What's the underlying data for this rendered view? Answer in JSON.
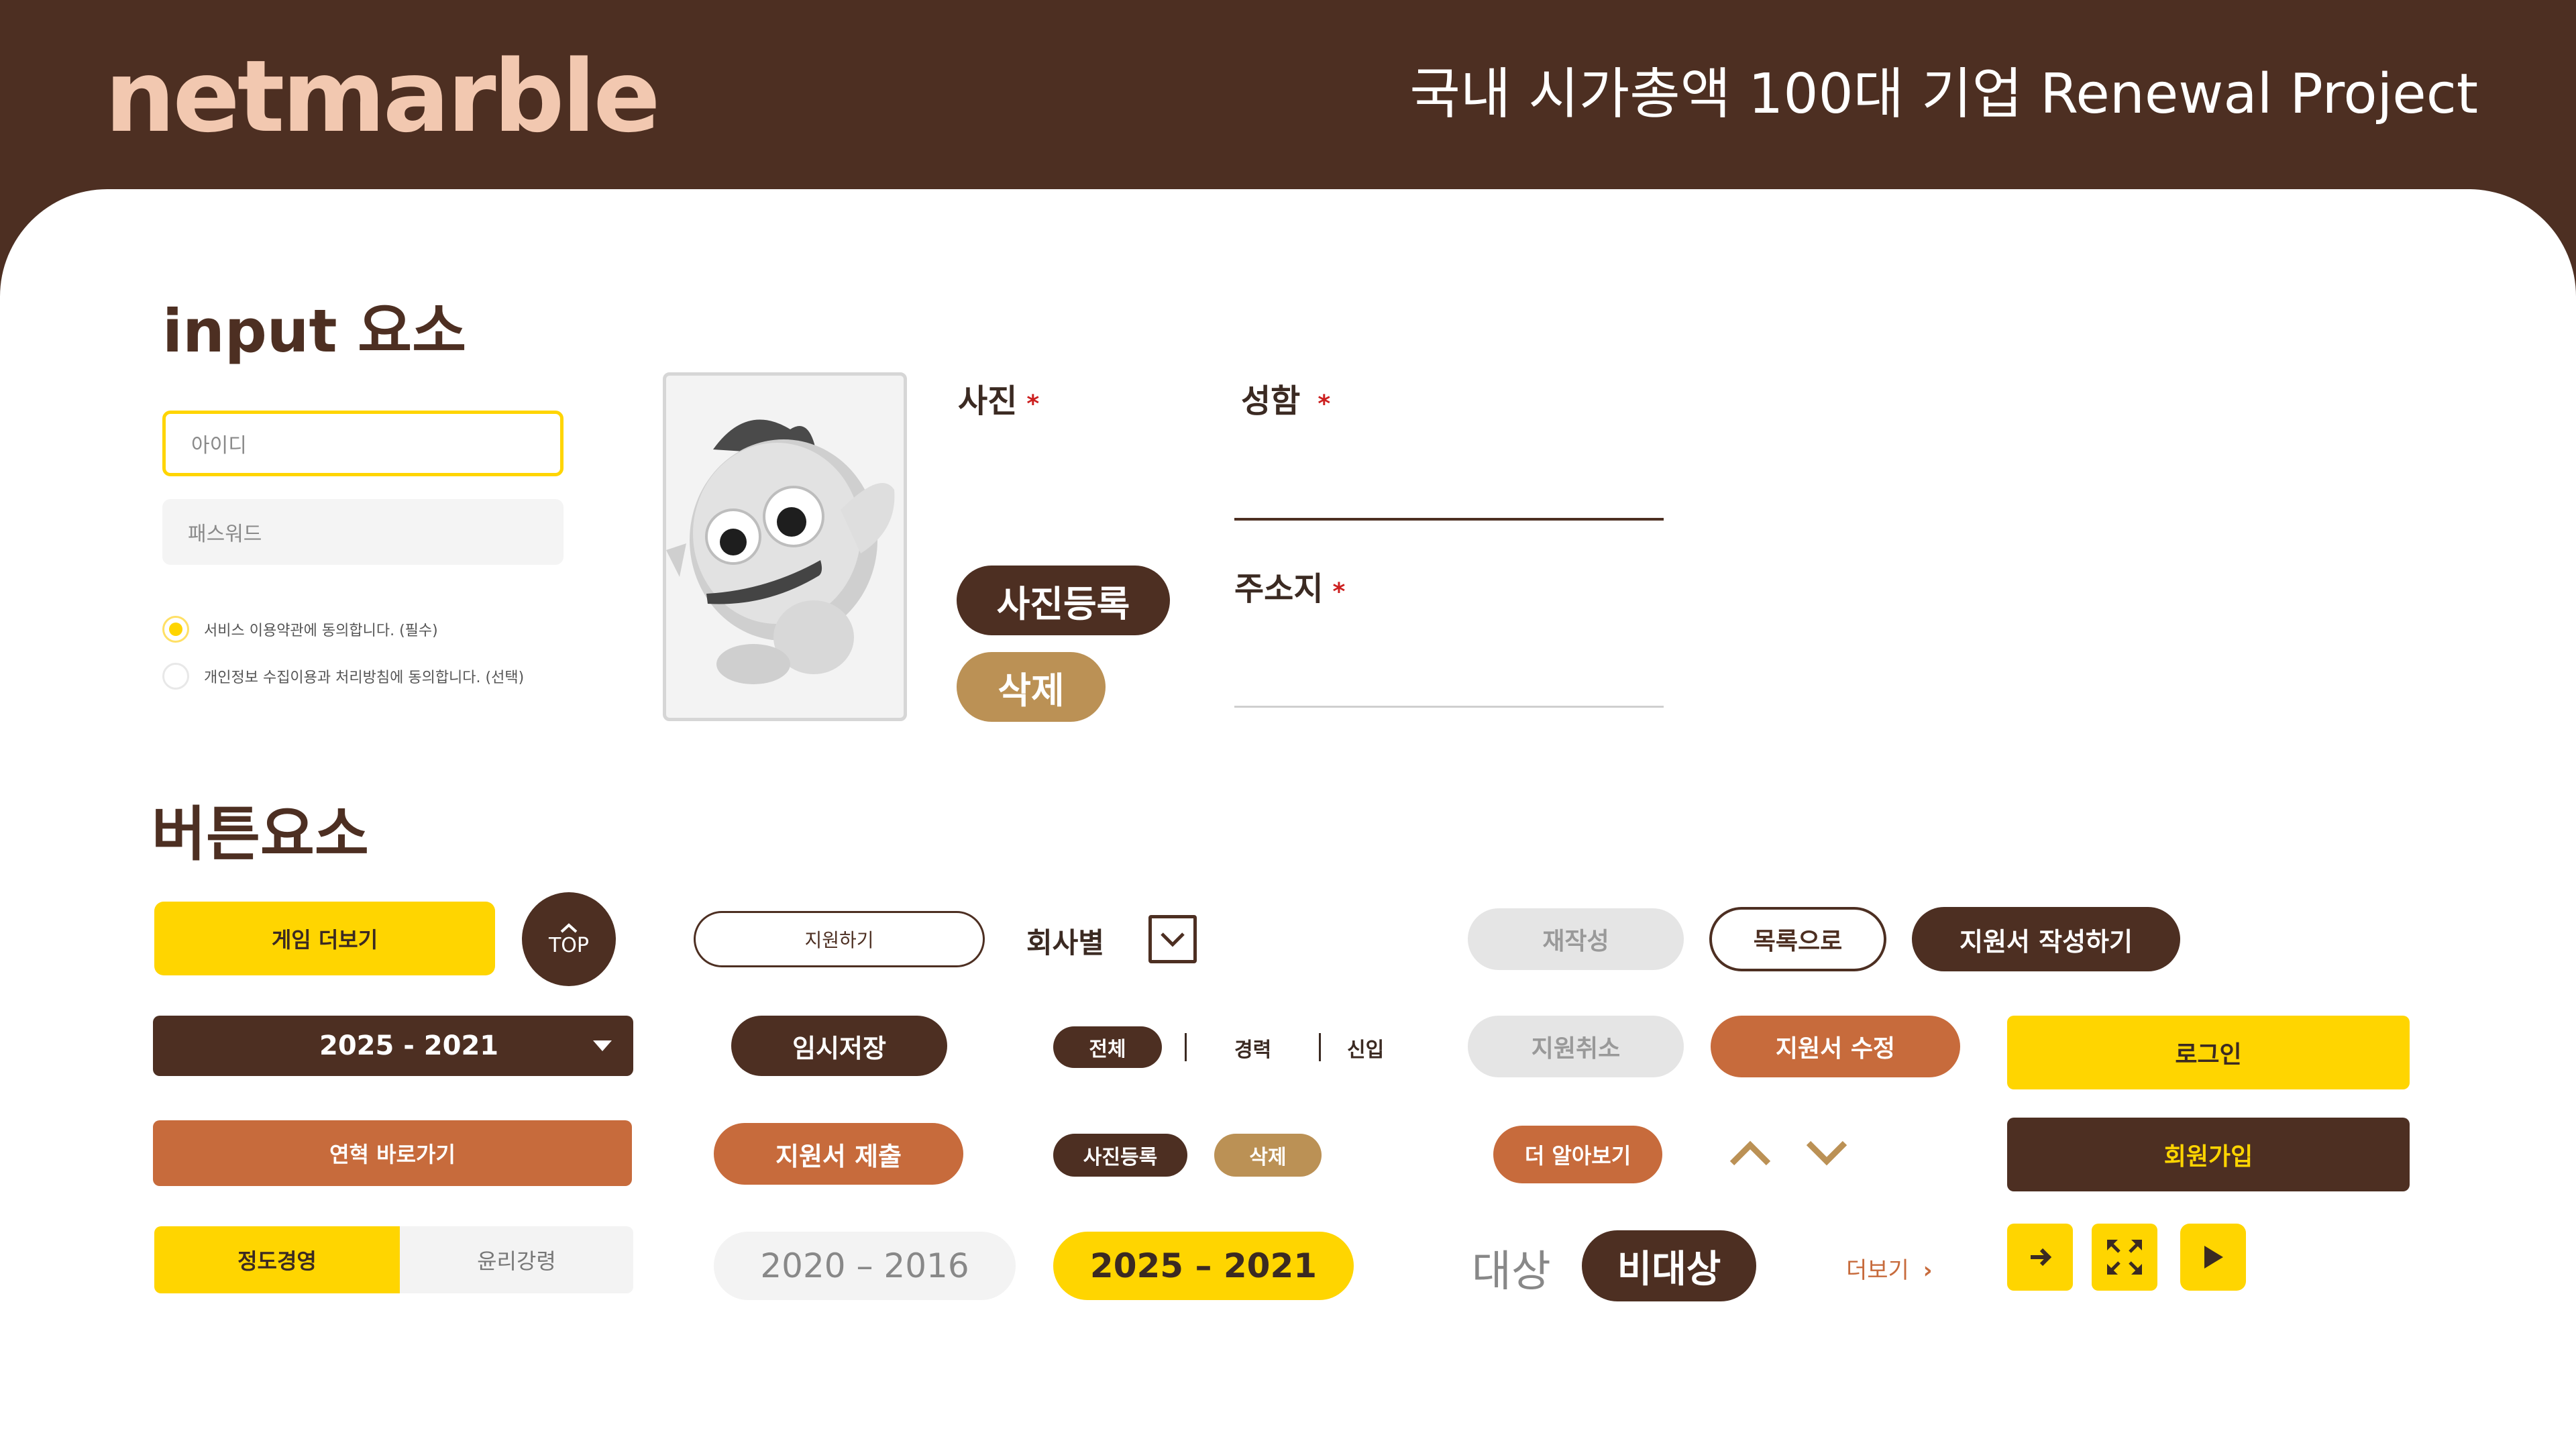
{
  "header": {
    "logo": "netmarble",
    "title": "국내 시가총액 100대 기업 Renewal Project"
  },
  "input_section": {
    "title": "input 요소",
    "id_placeholder": "아이디",
    "pw_placeholder": "패스워드",
    "agree_required": "서비스 이용약관에 동의합니다. (필수)",
    "agree_optional": "개인정보 수집이용과 처리방침에 동의합니다. (선택)",
    "photo_label": "사진",
    "name_label": "성함",
    "address_label": "주소지",
    "required_mark": "*",
    "photo_register": "사진등록",
    "photo_delete": "삭제"
  },
  "button_section": {
    "title": "버튼요소",
    "more_games": "게임 더보기",
    "top": "TOP",
    "apply": "지원하기",
    "by_company": "회사별",
    "year_select": "2025 - 2021",
    "temp_save": "임시저장",
    "filter_all": "전체",
    "filter_career": "경력",
    "filter_new": "신입",
    "history_link": "연혁 바로가기",
    "submit_app": "지원서 제출",
    "photo_register_sm": "사진등록",
    "delete_sm": "삭제",
    "ethics_tab": "정도경영",
    "ethics_charter": "윤리강령",
    "year_range_off": "2020 – 2016",
    "year_range_on": "2025 – 2021",
    "rework": "재작성",
    "to_list": "목록으로",
    "write_app": "지원서 작성하기",
    "cancel_app": "지원취소",
    "edit_app": "지원서 수정",
    "login": "로그인",
    "learn_more": "더 알아보기",
    "signup": "회원가입",
    "target": "대상",
    "non_target": "비대상",
    "see_more": "더보기",
    "see_more_arrow": "›"
  },
  "colors": {
    "brown": "#4d2f22",
    "yellow": "#ffd500",
    "orange": "#c76b3c",
    "tan": "#bb9155",
    "peach": "#f2c8b0",
    "required": "#cc1f1f"
  }
}
